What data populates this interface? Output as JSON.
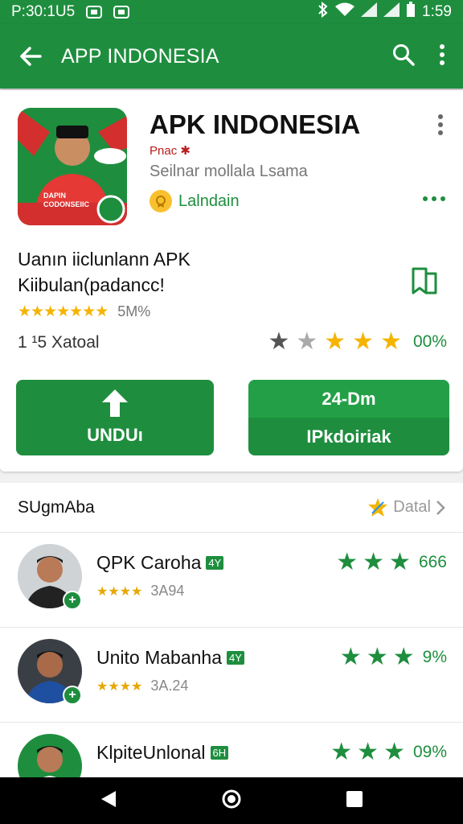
{
  "status": {
    "time_left": "P:30:1U5",
    "time_right": "1:59"
  },
  "appbar": {
    "title": "APP INDONESIA"
  },
  "app": {
    "name": "APK INDONESIA",
    "developer": "Pnac ✱",
    "subtitle": "Seilnar mollala Lsama",
    "badge_label": "Lalndain",
    "icon_text_line1": "DAPIN",
    "icon_text_line2": "CODONSEIIC",
    "description_line1": "Uanın iiclunlann APK",
    "description_line2": "Kiibulan(padancc!",
    "rating_stars": "★★★★★★★",
    "rating_value": "5M%",
    "install_count": "1 ¹5 Xatoal",
    "right_percent": "00%",
    "download_label": "UNDUı",
    "button_top_label": "24-Dm",
    "button_bottom_label": "IPkdoiriak"
  },
  "suggest": {
    "title": "SUgmAba",
    "detail_label": "Datal",
    "items": [
      {
        "name": "QPK Caroha",
        "tag": "4Y",
        "meta_stars": "★★★★",
        "meta_value": "3A94",
        "rating": "666"
      },
      {
        "name": "Unito Mabanha",
        "tag": "4Y",
        "meta_stars": "★★★★",
        "meta_value": "3A.24",
        "rating": "9%"
      },
      {
        "name": "KlpiteUnlonal",
        "tag": "6H",
        "meta_stars": "",
        "meta_value": "",
        "rating": "09%"
      }
    ]
  },
  "colors": {
    "primary": "#1e8e3e",
    "star_yellow": "#f5b400"
  }
}
